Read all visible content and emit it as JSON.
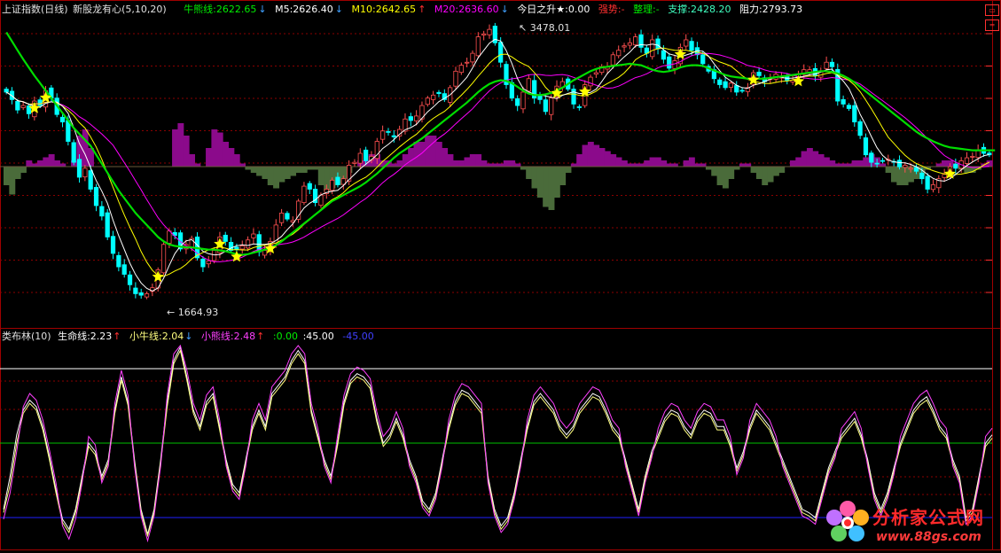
{
  "colors": {
    "bg": "#000000",
    "up": "#ff5050",
    "down": "#00ffff",
    "niu": "#00dd00",
    "m5": "#ffffff",
    "m10": "#ffff00",
    "m20": "#ff00ff",
    "zhicheng": "#40ffc0",
    "hist_pos": "#8b0a8b",
    "hist_neg": "#4a6b3a",
    "star": "#ffff00",
    "sub_life": "#ffffff",
    "sub_calf": "#ffff80",
    "sub_bear": "#ff40ff",
    "ref_top": "#ffffff",
    "ref_mid": "#00c000",
    "ref_low": "#2020ff",
    "grid": "#8b0000",
    "frame": "#a00000"
  },
  "main_header": {
    "title": "上证指数(日线)",
    "indicator": "新股龙有心(5,10,20)",
    "niu": "牛熊线:2622.65",
    "niu_arrow": "↓",
    "m5": "M5:2626.40",
    "m5_arrow": "↓",
    "m10": "M10:2642.65",
    "m10_arrow": "↑",
    "m20": "M20:2636.60",
    "m20_arrow": "↓",
    "today": "今日之升★:0.00",
    "strong": "强势:-",
    "zhengli": "整理:-",
    "support": "支撑:2428.20",
    "resist": "阻力:2793.73"
  },
  "annotations": {
    "high": "3478.01",
    "low": "1664.93"
  },
  "sub_header": {
    "name": "类布林(10)",
    "life": "生命线:2.23",
    "life_arrow": "↑",
    "calf": "小牛线:2.04",
    "calf_arrow": "↓",
    "bear": "小熊线:2.48",
    "bear_arrow": "↑",
    "v0": ":0.00",
    "v45": ":45.00",
    "vm45": "-45.00"
  },
  "watermark": {
    "cn": "分析家公式网",
    "url": "www.88gs.com"
  },
  "chart_data": [
    {
      "type": "candlestick",
      "title": "上证指数(日线)",
      "ylim": [
        1560,
        3560
      ],
      "high_label": 3478.01,
      "low_label": 1664.93,
      "close": [
        3050,
        3000,
        2930,
        2960,
        2905,
        2990,
        2960,
        3060,
        3010,
        2900,
        2850,
        2720,
        2580,
        2480,
        2540,
        2400,
        2290,
        2220,
        2080,
        1970,
        1880,
        1830,
        1760,
        1700,
        1690,
        1700,
        1740,
        1860,
        2030,
        2120,
        2090,
        2000,
        2030,
        2070,
        1940,
        1880,
        1920,
        1990,
        2080,
        2050,
        1990,
        1995,
        2020,
        2060,
        2100,
        1980,
        1990,
        2050,
        2160,
        2240,
        2200,
        2190,
        2320,
        2420,
        2400,
        2310,
        2360,
        2400,
        2460,
        2430,
        2470,
        2560,
        2580,
        2640,
        2590,
        2620,
        2720,
        2790,
        2780,
        2750,
        2800,
        2870,
        2860,
        2890,
        2960,
        3010,
        3030,
        3040,
        3000,
        3080,
        3190,
        3230,
        3250,
        3310,
        3420,
        3440,
        3470,
        3380,
        3250,
        3100,
        3010,
        2960,
        3050,
        3140,
        3010,
        3000,
        2920,
        3010,
        3090,
        3120,
        3070,
        2970,
        2950,
        3100,
        3150,
        3180,
        3220,
        3220,
        3300,
        3330,
        3360,
        3380,
        3420,
        3350,
        3310,
        3400,
        3340,
        3270,
        3210,
        3260,
        3350,
        3400,
        3330,
        3300,
        3240,
        3190,
        3140,
        3100,
        3080,
        3110,
        3050,
        3060,
        3080,
        3180,
        3160,
        3120,
        3140,
        3170,
        3150,
        3130,
        3130,
        3170,
        3200,
        3200,
        3160,
        3190,
        3250,
        3220,
        2990,
        2970,
        2940,
        2850,
        2760,
        2630,
        2580,
        2570,
        2590,
        2600,
        2580,
        2550,
        2560,
        2540,
        2520,
        2470,
        2400,
        2430,
        2470,
        2500,
        2550,
        2540,
        2590,
        2610,
        2620,
        2660,
        2640,
        2630
      ],
      "life_line": [
        3450,
        3390,
        3330,
        3270,
        3215,
        3160,
        3110,
        3060,
        3010,
        2960,
        2910,
        2860,
        2810,
        2770,
        2730,
        2690,
        2630,
        2570,
        2510,
        2450,
        2390,
        2340,
        2290,
        2240,
        2200,
        2160,
        2120,
        2080,
        2050,
        2030,
        2020,
        2015,
        2010,
        2010,
        2005,
        2000,
        1995,
        1995,
        1990,
        1985,
        1975,
        1965,
        1960,
        1965,
        1975,
        1985,
        1995,
        2005,
        2025,
        2050,
        2080,
        2110,
        2140,
        2170,
        2200,
        2230,
        2260,
        2290,
        2320,
        2340,
        2360,
        2380,
        2400,
        2420,
        2445,
        2475,
        2505,
        2540,
        2575,
        2610,
        2640,
        2665,
        2690,
        2715,
        2740,
        2770,
        2800,
        2830,
        2860,
        2890,
        2920,
        2950,
        2980,
        3015,
        3050,
        3080,
        3105,
        3120,
        3130,
        3125,
        3110,
        3085,
        3060,
        3040,
        3030,
        3030,
        3035,
        3045,
        3060,
        3080,
        3105,
        3130,
        3150,
        3170,
        3190,
        3205,
        3215,
        3220,
        3225,
        3230,
        3235,
        3240,
        3235,
        3230,
        3215,
        3200,
        3190,
        3185,
        3190,
        3200,
        3215,
        3225,
        3230,
        3230,
        3225,
        3210,
        3195,
        3180,
        3165,
        3155,
        3150,
        3145,
        3140,
        3140,
        3140,
        3140,
        3145,
        3150,
        3155,
        3160,
        3165,
        3170,
        3175,
        3180,
        3185,
        3190,
        3190,
        3185,
        3175,
        3160,
        3140,
        3115,
        3085,
        3055,
        3025,
        2995,
        2965,
        2935,
        2905,
        2875,
        2845,
        2815,
        2785,
        2760,
        2740,
        2720,
        2705,
        2690,
        2680,
        2675,
        2670,
        2665,
        2660,
        2660,
        2660,
        2660,
        2660
      ],
      "hist": [
        -30,
        -45,
        -20,
        -10,
        10,
        5,
        10,
        15,
        20,
        10,
        5,
        0,
        10,
        50,
        60,
        30,
        0,
        0,
        0,
        0,
        0,
        0,
        0,
        0,
        0,
        0,
        0,
        0,
        0,
        0,
        60,
        70,
        50,
        20,
        5,
        0,
        30,
        60,
        55,
        40,
        30,
        20,
        5,
        -5,
        -10,
        -15,
        -20,
        -30,
        -35,
        -25,
        -20,
        -15,
        -10,
        -10,
        -5,
        -5,
        -30,
        -40,
        -35,
        -30,
        -20,
        -10,
        0,
        10,
        10,
        20,
        20,
        10,
        10,
        5,
        10,
        20,
        30,
        40,
        40,
        50,
        50,
        40,
        30,
        20,
        10,
        10,
        15,
        20,
        20,
        10,
        5,
        5,
        5,
        10,
        10,
        5,
        -5,
        -20,
        -35,
        -50,
        -65,
        -70,
        -50,
        -30,
        -10,
        5,
        20,
        35,
        40,
        35,
        30,
        25,
        20,
        15,
        10,
        5,
        5,
        5,
        10,
        15,
        15,
        10,
        5,
        5,
        0,
        10,
        15,
        5,
        5,
        -5,
        -15,
        -30,
        -35,
        -20,
        -5,
        5,
        5,
        -10,
        -20,
        -30,
        -25,
        -15,
        -10,
        0,
        10,
        15,
        25,
        30,
        25,
        20,
        15,
        10,
        5,
        5,
        5,
        10,
        10,
        15,
        20,
        15,
        5,
        -10,
        -25,
        -30,
        -30,
        -25,
        -20,
        -15,
        -5,
        0,
        5,
        10,
        10,
        5,
        -5,
        -10,
        -10,
        -5,
        5,
        10,
        10,
        5,
        0,
        -5
      ]
    },
    {
      "type": "line",
      "title": "类布林(10)",
      "ylim": [
        -60,
        60
      ],
      "reference_lines": [
        45,
        0,
        -45
      ],
      "series": [
        {
          "name": "生命线",
          "values": [
            -40,
            -20,
            5,
            20,
            26,
            22,
            10,
            -8,
            -28,
            -46,
            -52,
            -40,
            -20,
            0,
            -5,
            -20,
            -10,
            20,
            40,
            25,
            -10,
            -40,
            -55,
            -40,
            -10,
            25,
            50,
            58,
            40,
            20,
            10,
            25,
            30,
            10,
            -10,
            -25,
            -30,
            -10,
            10,
            20,
            10,
            30,
            35,
            40,
            50,
            56,
            50,
            20,
            5,
            -10,
            -20,
            0,
            25,
            38,
            42,
            40,
            35,
            15,
            0,
            5,
            15,
            5,
            -10,
            -20,
            -35,
            -40,
            -30,
            -10,
            10,
            25,
            32,
            30,
            25,
            20,
            -20,
            -40,
            -50,
            -45,
            -30,
            -10,
            10,
            25,
            30,
            25,
            20,
            10,
            5,
            10,
            20,
            25,
            30,
            28,
            20,
            10,
            5,
            -10,
            -25,
            -40,
            -20,
            -5,
            5,
            15,
            20,
            18,
            10,
            5,
            15,
            20,
            18,
            10,
            10,
            0,
            -15,
            -5,
            10,
            20,
            15,
            10,
            0,
            -10,
            -20,
            -30,
            -40,
            -42,
            -45,
            -30,
            -15,
            -5,
            5,
            10,
            15,
            5,
            -10,
            -30,
            -40,
            -30,
            -15,
            0,
            10,
            20,
            25,
            28,
            20,
            10,
            5,
            -10,
            -20,
            -45,
            -40,
            -20,
            0,
            5
          ],
          "source": "",
          "type": ""
        },
        {
          "name": "小牛线",
          "values": [
            -42,
            -25,
            0,
            18,
            24,
            20,
            8,
            -10,
            -30,
            -48,
            -54,
            -42,
            -22,
            -2,
            -7,
            -22,
            -12,
            18,
            38,
            23,
            -12,
            -42,
            -56,
            -42,
            -12,
            22,
            48,
            56,
            38,
            18,
            8,
            23,
            28,
            8,
            -12,
            -27,
            -32,
            -12,
            8,
            18,
            8,
            28,
            33,
            38,
            48,
            54,
            48,
            18,
            3,
            -12,
            -22,
            -2,
            23,
            36,
            40,
            38,
            33,
            13,
            -2,
            3,
            13,
            3,
            -12,
            -22,
            -37,
            -42,
            -32,
            -12,
            8,
            23,
            30,
            28,
            23,
            18,
            -22,
            -42,
            -52,
            -47,
            -32,
            -12,
            8,
            23,
            28,
            23,
            18,
            8,
            3,
            8,
            18,
            23,
            28,
            26,
            18,
            8,
            3,
            -12,
            -27,
            -42,
            -22,
            -7,
            3,
            13,
            18,
            16,
            8,
            3,
            13,
            18,
            16,
            8,
            8,
            -2,
            -17,
            -7,
            8,
            18,
            13,
            8,
            -2,
            -12,
            -22,
            -32,
            -42,
            -44,
            -47,
            -32,
            -17,
            -7,
            3,
            8,
            13,
            3,
            -12,
            -32,
            -42,
            -32,
            -17,
            -2,
            8,
            18,
            23,
            26,
            18,
            8,
            3,
            -12,
            -22,
            -47,
            -42,
            -22,
            -2,
            3
          ]
        },
        {
          "name": "小熊线",
          "values": [
            -46,
            -30,
            -5,
            22,
            30,
            26,
            14,
            -4,
            -24,
            -50,
            -58,
            -46,
            -24,
            4,
            -1,
            -24,
            -14,
            24,
            44,
            29,
            -14,
            -44,
            -59,
            -44,
            -14,
            29,
            54,
            59,
            44,
            24,
            14,
            29,
            34,
            14,
            -14,
            -29,
            -34,
            -14,
            14,
            24,
            14,
            34,
            39,
            44,
            54,
            59,
            54,
            24,
            9,
            -14,
            -24,
            4,
            29,
            42,
            46,
            44,
            39,
            19,
            4,
            9,
            19,
            9,
            -14,
            -24,
            -39,
            -44,
            -34,
            -14,
            14,
            29,
            36,
            34,
            29,
            24,
            -24,
            -44,
            -54,
            -49,
            -34,
            -14,
            14,
            29,
            34,
            29,
            24,
            14,
            9,
            14,
            24,
            29,
            34,
            32,
            24,
            14,
            9,
            -14,
            -29,
            -44,
            -24,
            -9,
            9,
            19,
            24,
            22,
            14,
            9,
            19,
            24,
            22,
            14,
            14,
            4,
            -19,
            -9,
            14,
            24,
            19,
            14,
            4,
            -14,
            -24,
            -34,
            -44,
            -46,
            -49,
            -34,
            -19,
            -9,
            9,
            14,
            19,
            9,
            -14,
            -34,
            -44,
            -34,
            -19,
            4,
            14,
            24,
            29,
            32,
            24,
            14,
            9,
            -14,
            -24,
            -49,
            -44,
            -24,
            4,
            9
          ]
        }
      ]
    }
  ]
}
